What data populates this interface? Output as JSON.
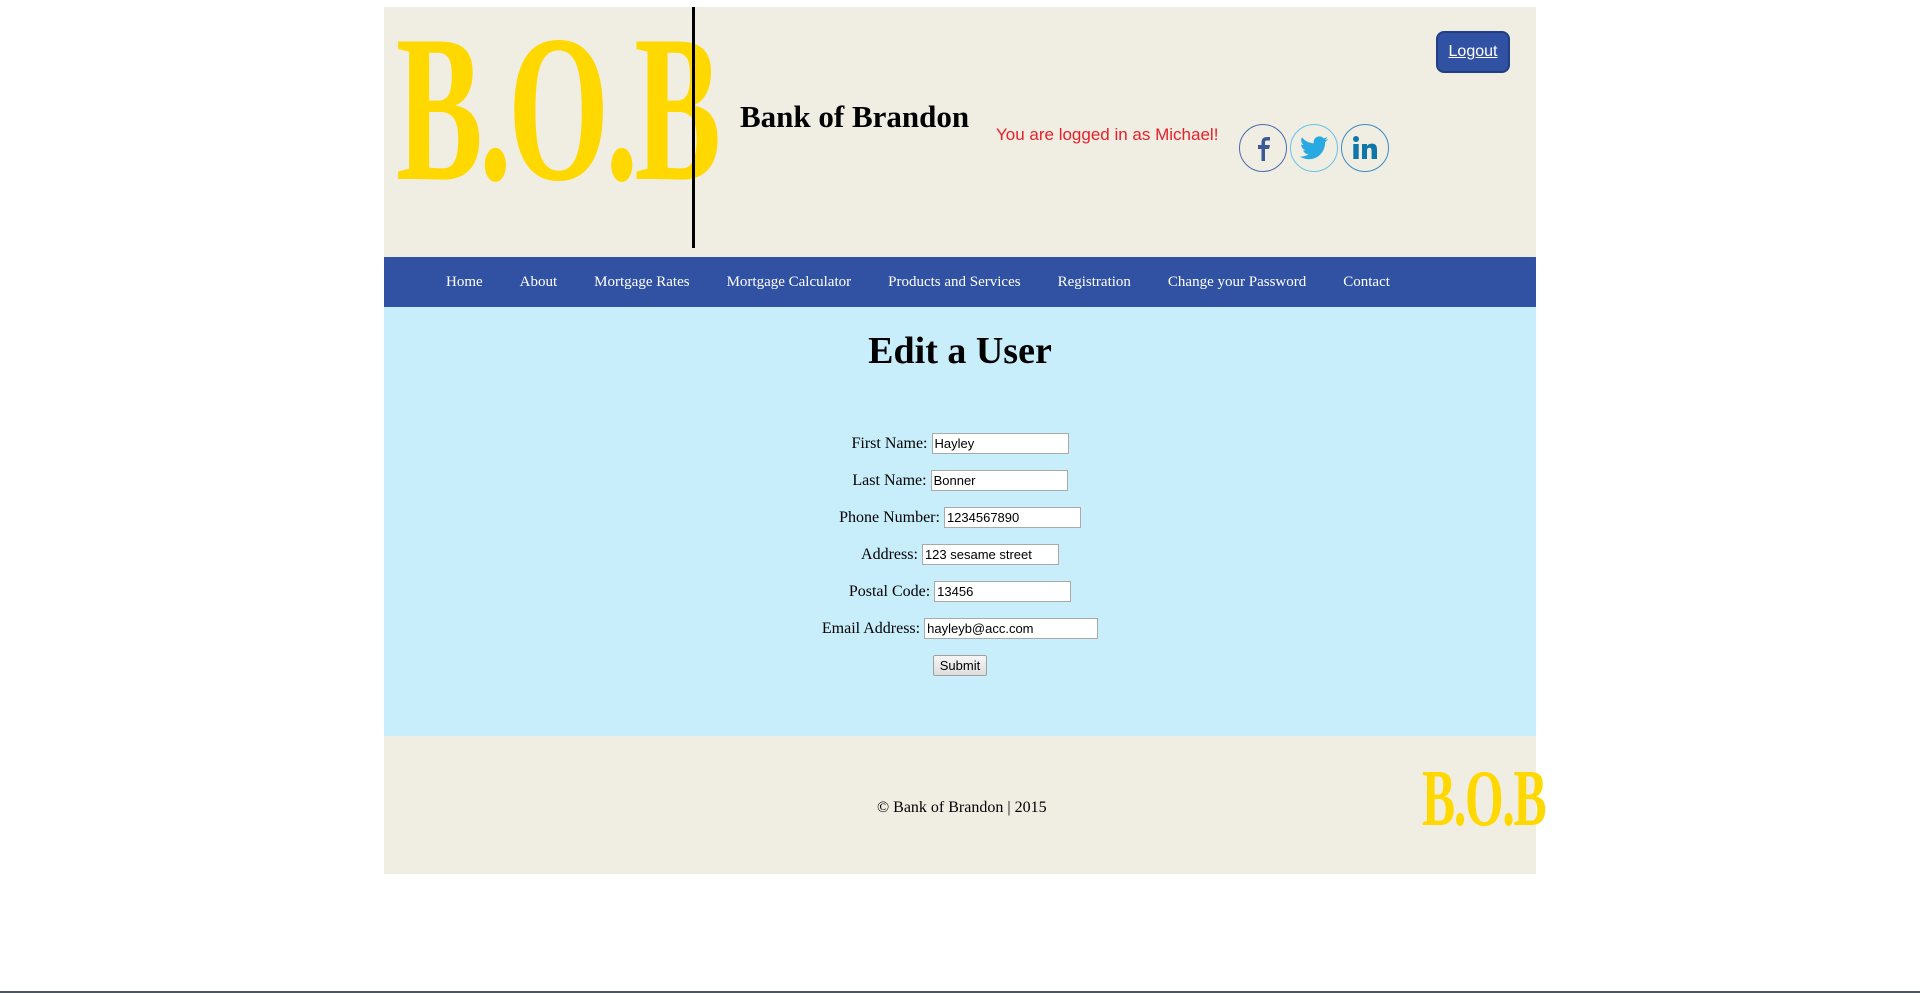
{
  "header": {
    "logo_text": "B.O.B",
    "site_title": "Bank of Brandon",
    "logged_in_message": "You are logged in as Michael!",
    "logout_label": "Logout",
    "social": [
      {
        "name": "facebook",
        "icon": "facebook-icon",
        "glyph": "f",
        "color": "#3b5998"
      },
      {
        "name": "twitter",
        "icon": "twitter-icon",
        "glyph": "🐦",
        "color": "#29a9e1"
      },
      {
        "name": "linkedin",
        "icon": "linkedin-icon",
        "glyph": "in",
        "color": "#0e76a8"
      }
    ]
  },
  "nav": {
    "items": [
      {
        "label": "Home"
      },
      {
        "label": "About"
      },
      {
        "label": "Mortgage Rates"
      },
      {
        "label": "Mortgage Calculator"
      },
      {
        "label": "Products and Services"
      },
      {
        "label": "Registration"
      },
      {
        "label": "Change your Password"
      },
      {
        "label": "Contact"
      }
    ]
  },
  "main": {
    "title": "Edit a User",
    "fields": [
      {
        "label": "First Name:",
        "value": "Hayley"
      },
      {
        "label": "Last Name:",
        "value": "Bonner"
      },
      {
        "label": "Phone Number:",
        "value": "1234567890"
      },
      {
        "label": "Address:",
        "value": "123 sesame street"
      },
      {
        "label": "Postal Code:",
        "value": "13456"
      },
      {
        "label": "Email Address:",
        "value": "hayleyb@acc.com"
      }
    ],
    "submit_label": "Submit"
  },
  "footer": {
    "copyright": "© Bank of Brandon | 2015",
    "logo_text": "B.O.B"
  },
  "colors": {
    "brand_yellow": "#ffd800",
    "nav_blue": "#3152a3",
    "header_bg": "#f0ede3",
    "main_bg": "#c8eefc",
    "alert_red": "#e8202a"
  }
}
